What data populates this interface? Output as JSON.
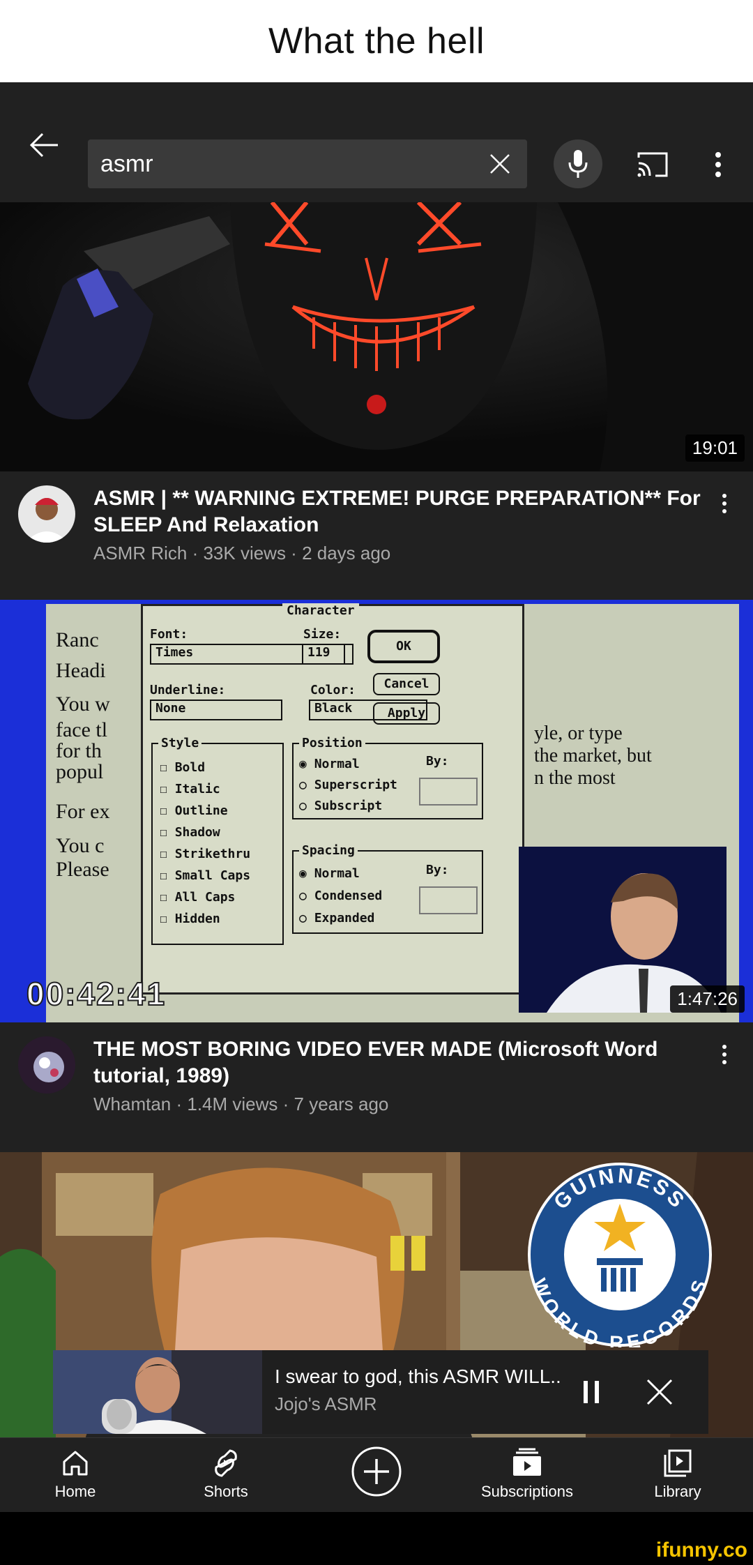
{
  "meme_caption": "What the hell",
  "search": {
    "value": "asmr"
  },
  "videos": [
    {
      "title": "ASMR | ** WARNING EXTREME! PURGE PREPARATION** For SLEEP And Relaxation",
      "meta": "ASMR Rich · 33K views · 2 days ago",
      "duration": "19:01"
    },
    {
      "title": "THE MOST BORING VIDEO EVER MADE (Microsoft Word tutorial, 1989)",
      "meta": "Whamtan · 1.4M views · 7 years ago",
      "duration": "1:47:26",
      "thumb_timecode": "00:42:41",
      "dialog": {
        "header": "Character",
        "font_label": "Font:",
        "font_value": "Times",
        "size_label": "Size:",
        "size_value": "119",
        "underline_label": "Underline:",
        "underline_value": "None",
        "color_label": "Color:",
        "color_value": "Black",
        "ok": "OK",
        "cancel": "Cancel",
        "apply": "Apply",
        "style_label": "Style",
        "styles": [
          "Bold",
          "Italic",
          "Outline",
          "Shadow",
          "Strikethru",
          "Small Caps",
          "All Caps",
          "Hidden"
        ],
        "position_label": "Position",
        "positions": [
          "Normal",
          "Superscript",
          "Subscript"
        ],
        "spacing_label": "Spacing",
        "spacings": [
          "Normal",
          "Condensed",
          "Expanded"
        ],
        "by": "By:",
        "doc_left": [
          "Ranc",
          "Headi",
          "You w",
          "face tl",
          "for th",
          "popul",
          "For ex",
          "You c",
          "Please"
        ],
        "doc_right": [
          "yle, or type",
          "the market, but",
          "n the most"
        ]
      }
    },
    {
      "badge_top": "GUINNESS",
      "badge_bottom": "WORLD RECORDS"
    }
  ],
  "miniplayer": {
    "title": "I swear to god, this ASMR WILL..",
    "channel": "Jojo's ASMR"
  },
  "nav": [
    {
      "label": "Home",
      "icon": "home-icon"
    },
    {
      "label": "Shorts",
      "icon": "shorts-icon"
    },
    {
      "label": "",
      "icon": "create-icon"
    },
    {
      "label": "Subscriptions",
      "icon": "subscriptions-icon"
    },
    {
      "label": "Library",
      "icon": "library-icon"
    }
  ],
  "watermark": "ifunny.co"
}
